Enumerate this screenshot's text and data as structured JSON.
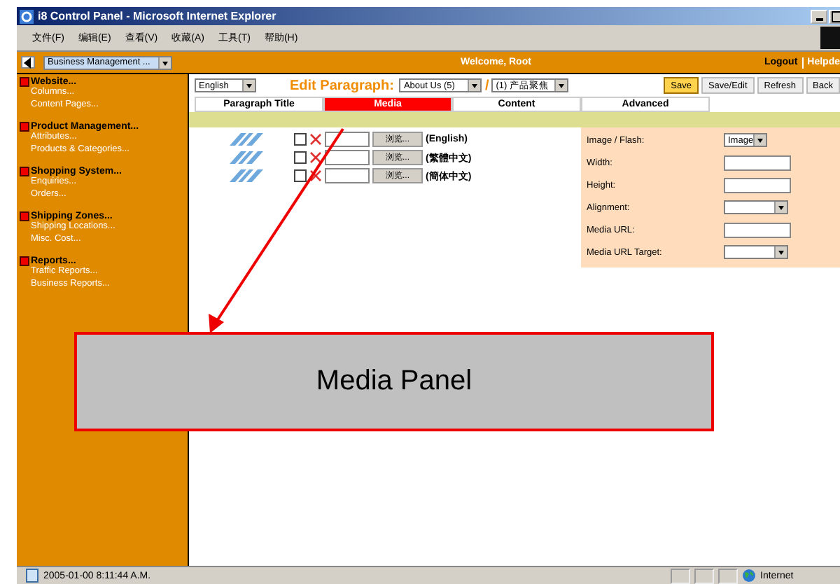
{
  "window": {
    "title": "i8 Control Panel - Microsoft Internet Explorer"
  },
  "menu_bar": [
    "文件(F)",
    "编辑(E)",
    "查看(V)",
    "收藏(A)",
    "工具(T)",
    "帮助(H)"
  ],
  "top_bar": {
    "section_select": "Business Management ...",
    "welcome": "Welcome, Root",
    "links": [
      "Logout",
      "Helpde"
    ]
  },
  "sidebar": {
    "groups": [
      {
        "title": "Website...",
        "items": [
          "Columns...",
          "Content Pages..."
        ]
      },
      {
        "title": "Product Management...",
        "items": [
          "Attributes...",
          "Products & Categories..."
        ]
      },
      {
        "title": "Shopping System...",
        "items": [
          "Enquiries...",
          "Orders..."
        ]
      },
      {
        "title": "Shipping Zones...",
        "items": [
          "Shipping Locations...",
          "Misc. Cost..."
        ]
      },
      {
        "title": "Reports...",
        "items": [
          "Traffic Reports...",
          "Business Reports..."
        ]
      }
    ]
  },
  "editor": {
    "language_select": "English",
    "heading": "Edit Paragraph:",
    "separator": "/",
    "page_select": "About Us (5)",
    "paragraph_select": "(1) 产品聚焦",
    "buttons": [
      {
        "label": "Save",
        "kind": "primary"
      },
      {
        "label": "Save/Edit",
        "kind": "normal"
      },
      {
        "label": "Refresh",
        "kind": "normal"
      },
      {
        "label": "Back",
        "kind": "normal"
      }
    ],
    "tabs": [
      {
        "label": "Paragraph Title",
        "selected": false
      },
      {
        "label": "Media",
        "selected": true
      },
      {
        "label": "Content",
        "selected": false
      },
      {
        "label": "Advanced",
        "selected": false
      }
    ],
    "media_rows": [
      {
        "language": "(English)",
        "checked": false,
        "browse": "浏览..."
      },
      {
        "language": "(繁體中文)",
        "checked": false,
        "browse": "浏览..."
      },
      {
        "language": "(簡体中文)",
        "checked": false,
        "browse": "浏览..."
      }
    ],
    "properties": [
      {
        "label": "Image / Flash:",
        "kind": "select",
        "value": "Image"
      },
      {
        "label": "Width:",
        "kind": "text"
      },
      {
        "label": "Height:",
        "kind": "text"
      },
      {
        "label": "Alignment:",
        "kind": "select"
      },
      {
        "label": "Media URL:",
        "kind": "text"
      },
      {
        "label": "Media URL Target:",
        "kind": "select"
      }
    ]
  },
  "annotation": {
    "label": "Media Panel"
  },
  "status_bar": {
    "time": "2005-01-00 8:11:44 A.M.",
    "zone": "Internet"
  }
}
